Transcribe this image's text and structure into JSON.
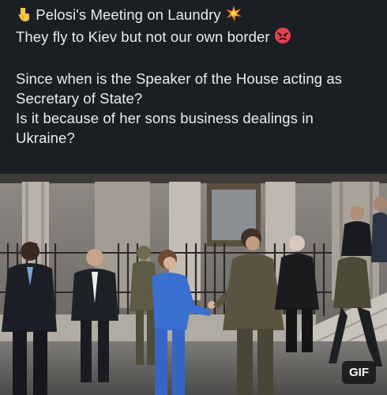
{
  "post": {
    "lines": [
      "Pelosi's Meeting on Laundry",
      "They fly to Kiev but not our own border",
      "Since when is the Speaker of the House acting as",
      "Secretary of State?",
      "Is it because of her sons business dealings in",
      "Ukraine?"
    ]
  },
  "media": {
    "badge": "GIF"
  },
  "icons": {
    "line1_lead": "pointing-down-hand-icon",
    "line1_trail": "collision-spark-icon",
    "line2_trail": "angry-face-icon"
  },
  "colors": {
    "background": "#1b1f24",
    "text": "#e9ecef",
    "pelosi_suit": "#3b6fd0",
    "angry_face": "#e0434c"
  }
}
